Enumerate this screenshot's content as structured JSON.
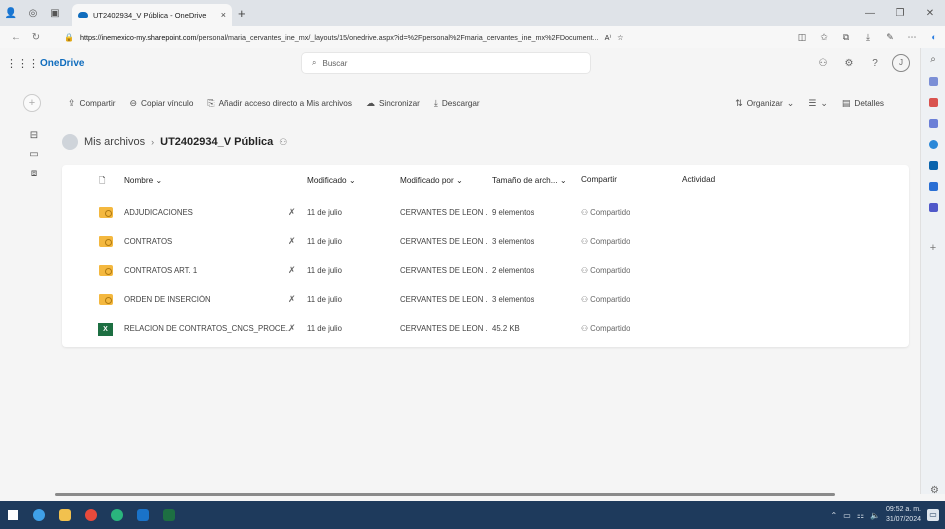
{
  "browser": {
    "tab_title": "UT2402934_V Pública - OneDrive",
    "tab_close": "×",
    "new_tab": "+",
    "url_host": "https://inemexico-my.sharepoint.com",
    "url_path": "/personal/maria_cervantes_ine_mx/_layouts/15/onedrive.aspx?id=%2Fpersonal%2Fmaria_cervantes_ine_mx%2FDocument...",
    "read_aloud": "A⁾"
  },
  "header": {
    "brand": "OneDrive",
    "search_placeholder": "Buscar"
  },
  "commands": {
    "share": "Compartir",
    "copy_link": "Copiar vínculo",
    "add_shortcut": "Añadir acceso directo a Mis archivos",
    "sync": "Sincronizar",
    "download": "Descargar",
    "organize": "Organizar",
    "view": "",
    "details": "Detalles"
  },
  "breadcrumb": {
    "parent": "Mis archivos",
    "separator": "›",
    "current": "UT2402934_V Pública"
  },
  "table": {
    "headers": {
      "name": "Nombre",
      "modified": "Modificado",
      "modified_by": "Modificado por",
      "size": "Tamaño de arch...",
      "sharing": "Compartir",
      "activity": "Actividad"
    },
    "rows": [
      {
        "type": "folder",
        "name": "ADJUDICACIONES",
        "modified": "11 de julio",
        "modified_by": "CERVANTES DE LEON .",
        "size": "9 elementos",
        "sharing": "Compartido"
      },
      {
        "type": "folder",
        "name": "CONTRATOS",
        "modified": "11 de julio",
        "modified_by": "CERVANTES DE LEON .",
        "size": "3 elementos",
        "sharing": "Compartido"
      },
      {
        "type": "folder",
        "name": "CONTRATOS ART. 1",
        "modified": "11 de julio",
        "modified_by": "CERVANTES DE LEON .",
        "size": "2 elementos",
        "sharing": "Compartido"
      },
      {
        "type": "folder",
        "name": "ORDEN DE INSERCIÓN",
        "modified": "11 de julio",
        "modified_by": "CERVANTES DE LEON .",
        "size": "3 elementos",
        "sharing": "Compartido"
      },
      {
        "type": "excel",
        "name": "RELACION DE CONTRATOS_CNCS_PROCE...",
        "modified": "11 de julio",
        "modified_by": "CERVANTES DE LEON .",
        "size": "45.2 KB",
        "sharing": "Compartido"
      }
    ]
  },
  "taskbar": {
    "time": "09:52 a. m.",
    "date": "31/07/2024"
  },
  "colors": {
    "brand": "#0f6cbd",
    "folder": "#f4b83f",
    "excel": "#1d6f42",
    "taskbar": "#1e3a5c"
  }
}
